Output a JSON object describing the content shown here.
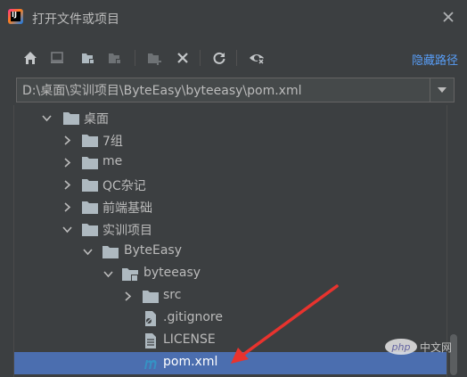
{
  "window": {
    "title": "打开文件或项目",
    "app_icon_text": "IJ"
  },
  "toolbar": {
    "buttons": [
      "home-icon",
      "desktop-icon",
      "project-folder-icon",
      "module-folder-icon",
      "new-folder-icon",
      "delete-icon",
      "refresh-icon",
      "show-hidden-icon"
    ],
    "hide_path_label": "隐藏路径"
  },
  "path": {
    "value": "D:\\桌面\\实训项目\\ByteEasy\\byteeasy\\pom.xml"
  },
  "tree": {
    "items": [
      {
        "label": "桌面",
        "expanded": true,
        "type": "folder"
      },
      {
        "label": "7组",
        "expanded": false,
        "type": "folder"
      },
      {
        "label": "me",
        "expanded": false,
        "type": "folder"
      },
      {
        "label": "QC杂记",
        "expanded": false,
        "type": "folder"
      },
      {
        "label": "前端基础",
        "expanded": false,
        "type": "folder"
      },
      {
        "label": "实训项目",
        "expanded": true,
        "type": "folder"
      },
      {
        "label": "ByteEasy",
        "expanded": true,
        "type": "folder"
      },
      {
        "label": "byteeasy",
        "expanded": true,
        "type": "module-folder"
      },
      {
        "label": "src",
        "expanded": false,
        "type": "folder"
      },
      {
        "label": ".gitignore",
        "type": "gitignore-file"
      },
      {
        "label": "LICENSE",
        "type": "text-file"
      },
      {
        "label": "pom.xml",
        "type": "maven-file",
        "selected": true
      }
    ]
  },
  "watermark": {
    "logo_text": "php",
    "text": "中文网"
  },
  "colors": {
    "background": "#3c3f41",
    "selection": "#4b6eaf",
    "link": "#589df6",
    "folder": "#aeb9c0",
    "maven": "#3592c4",
    "arrow": "#e8332e"
  }
}
